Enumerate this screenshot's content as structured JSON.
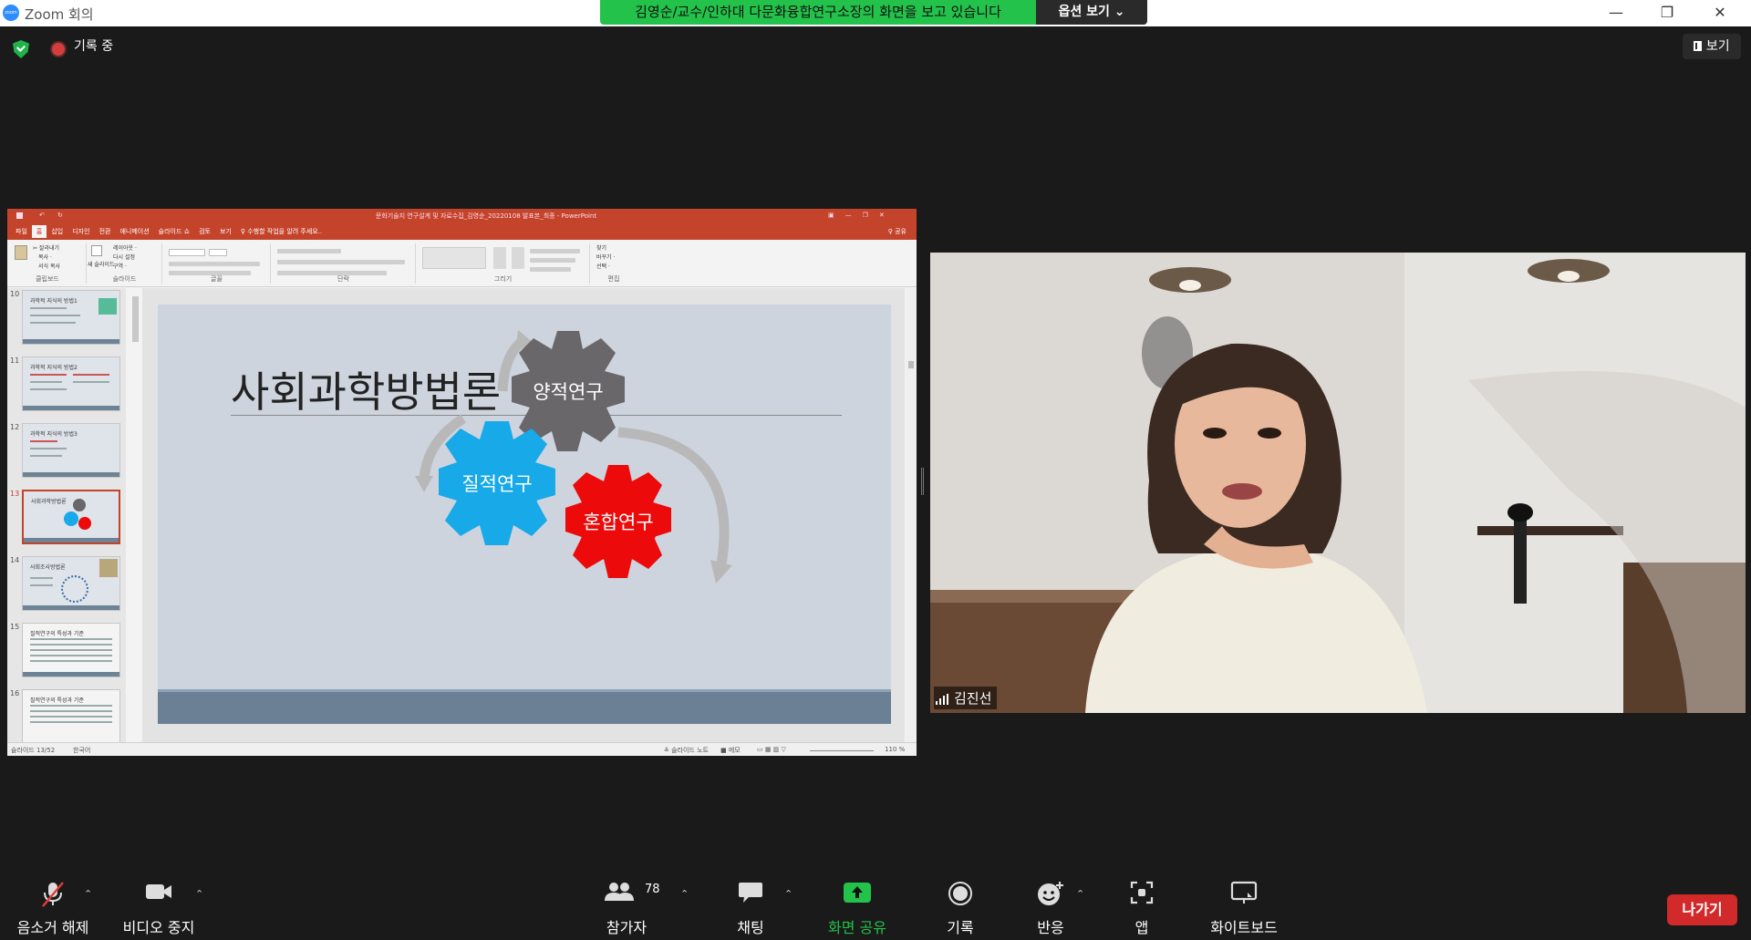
{
  "window": {
    "app_title": "Zoom 회의",
    "share_banner": "김영순/교수/인하대 다문화융합연구소장의 화면을 보고 있습니다",
    "options_button": "옵션 보기 ⌄",
    "minimize": "—",
    "restore": "❐",
    "close": "✕"
  },
  "status": {
    "recording": "기록 중",
    "view_button": "보기"
  },
  "ppt": {
    "doc_title": "문화기술지 연구설계 및 자료수집_김영순_20220108 발표본_최종 - PowerPoint",
    "tabs": [
      "파일",
      "홈",
      "삽입",
      "디자인",
      "전환",
      "애니메이션",
      "슬라이드 쇼",
      "검토",
      "보기",
      "♀ 수행할 작업을 알려 주세요.."
    ],
    "share_label": "♀ 공유",
    "ribbon_groups": [
      "클립보드",
      "슬라이드",
      "글꼴",
      "단락",
      "그리기",
      "편집"
    ],
    "clipboard_items": [
      "✂ 잘라내기",
      "복사 ·",
      "서식 복사"
    ],
    "slide_items": [
      "레이아웃 ·",
      "다시 설정",
      "구역 ·"
    ],
    "new_slide": "새 슬라이드",
    "edit_items": [
      "찾기",
      "바꾸기 ·",
      "선택 ·"
    ],
    "thumbnails": [
      {
        "num": "10",
        "title": "과학적 지식의 방법1"
      },
      {
        "num": "11",
        "title": "과학적 지식의 방법2"
      },
      {
        "num": "12",
        "title": "과학적 지식의 방법3"
      },
      {
        "num": "13",
        "title": "사회과학방법론"
      },
      {
        "num": "14",
        "title": "사회조사방법론"
      },
      {
        "num": "15",
        "title": "질적연구의 특성과 기준"
      },
      {
        "num": "16",
        "title": "질적연구의 특성과 기준"
      }
    ],
    "slide": {
      "title": "사회과학방법론",
      "gear_quant": "양적연구",
      "gear_qual": "질적연구",
      "gear_mixed": "혼합연구"
    },
    "statusbar": {
      "slide_count": "슬라이드 13/52",
      "language": "한국어",
      "notes": "≙ 슬라이드 노트",
      "memo": "■ 메모",
      "zoom": "110 %"
    }
  },
  "participant": {
    "name": "김진선"
  },
  "toolbar": {
    "unmute": "음소거 해제",
    "stop_video": "비디오 중지",
    "participants": "참가자",
    "participant_count": "78",
    "chat": "채팅",
    "share_screen": "화면 공유",
    "record": "기록",
    "reactions": "반응",
    "apps": "앱",
    "whiteboard": "화이트보드",
    "leave": "나가기"
  },
  "colors": {
    "zoom_green": "#23c24a",
    "share_green": "#23c24a",
    "ppt_red": "#c4432b",
    "gear_gray": "#6a676b",
    "gear_blue": "#18a9e8",
    "gear_red": "#ec0a0a",
    "leave_red": "#d2292a"
  }
}
